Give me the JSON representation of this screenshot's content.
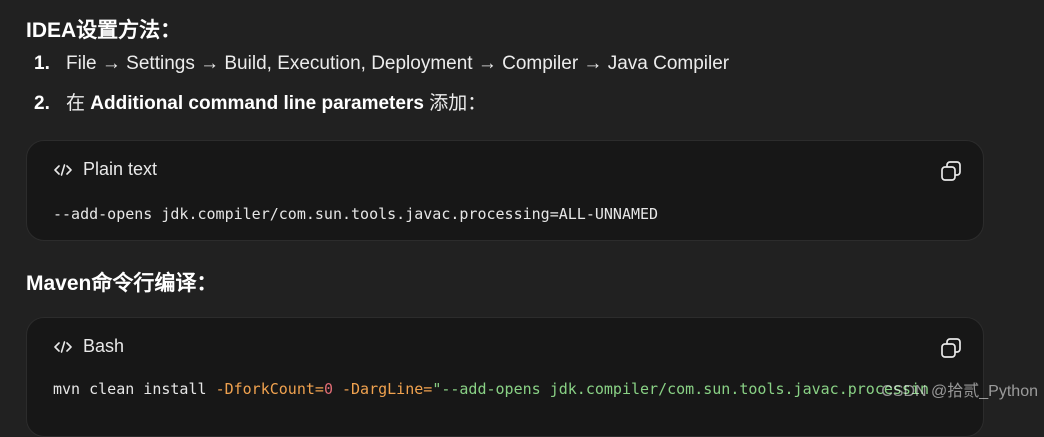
{
  "sections": {
    "idea_heading": "IDEA设置方法：",
    "maven_heading": "Maven命令行编译："
  },
  "steps": [
    {
      "num": "1.",
      "text": "File → Settings → Build, Execution, Deployment → Compiler → Java Compiler"
    },
    {
      "num": "2.",
      "prefix": "在 ",
      "bold": "Additional command line parameters",
      "suffix": " 添加："
    }
  ],
  "code_blocks": [
    {
      "lang_label": "Plain text",
      "lang_icon": "code-icon",
      "copy_icon": "copy-icon",
      "line": "--add-opens jdk.compiler/com.sun.tools.javac.processing=ALL-UNNAMED"
    },
    {
      "lang_label": "Bash",
      "lang_icon": "code-icon",
      "copy_icon": "copy-icon",
      "tokens": {
        "cmd": "mvn clean install ",
        "flag1": "-DforkCount=",
        "num1": "0",
        "space": " ",
        "flag2": "-DargLine=",
        "str": "\"--add-opens jdk.compiler/com.sun.tools.javac.processin"
      }
    }
  ],
  "watermark": "CSDN @拾贰_Python",
  "colors": {
    "background": "#212121",
    "code_background": "#171717",
    "flag": "#f0a24f",
    "number": "#e06c75",
    "string": "#89d185"
  }
}
